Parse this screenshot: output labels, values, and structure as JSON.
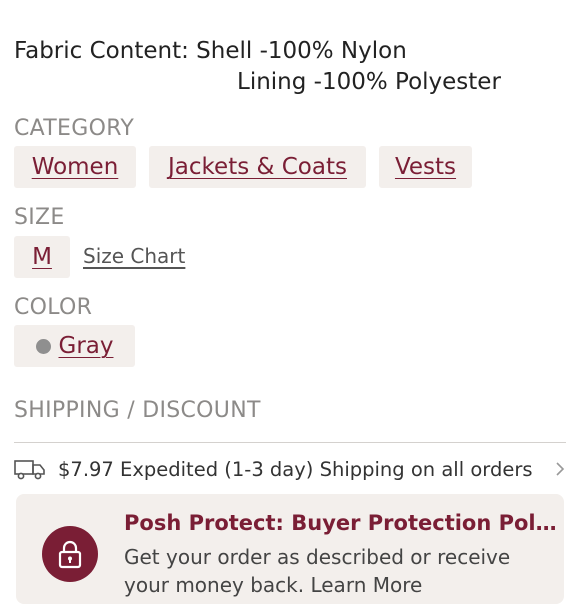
{
  "fabric": {
    "line1": "Fabric Content: Shell -100% Nylon",
    "line2": "Lining -100% Polyester"
  },
  "category": {
    "label": "CATEGORY",
    "chips": [
      "Women",
      "Jackets & Coats",
      "Vests"
    ]
  },
  "size": {
    "label": "SIZE",
    "value": "M",
    "chart_link": "Size Chart"
  },
  "color": {
    "label": "COLOR",
    "value": "Gray",
    "swatch": "#8f8f8f"
  },
  "shipping": {
    "label": "SHIPPING / DISCOUNT",
    "text": "$7.97 Expedited (1-3 day) Shipping on all orders",
    "icon": "truck-icon"
  },
  "protect": {
    "title": "Posh Protect: Buyer Protection Pol…",
    "line1": "Get your order as described or receive",
    "line2": "your money back. Learn More"
  },
  "colors": {
    "accent": "#7a1e35",
    "chip_bg": "#f3efec",
    "label_gray": "#8c8a88"
  }
}
